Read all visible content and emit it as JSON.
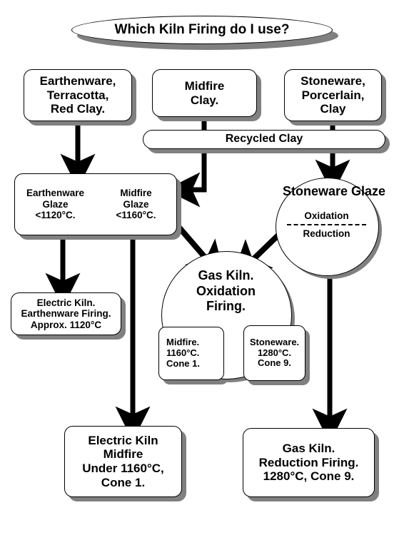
{
  "title": {
    "text": "Which Kiln Firing do I use?"
  },
  "clay_inputs": [
    {
      "name": "earthenware-clay",
      "lines": [
        "Earthenware,",
        "Terracotta,",
        "Red Clay."
      ]
    },
    {
      "name": "midfire-clay",
      "lines": [
        "Midfire",
        "Clay."
      ]
    },
    {
      "name": "stoneware-clay",
      "lines": [
        "Stoneware,",
        "Porcerlain,",
        "Clay"
      ]
    }
  ],
  "recycled": {
    "label": "Recycled Clay"
  },
  "glaze_box": {
    "left": {
      "lines": [
        "Earthenware",
        "Glaze",
        "<1120°C."
      ]
    },
    "right": {
      "lines": [
        "Midfire",
        "Glaze",
        "<1160°C."
      ]
    }
  },
  "stoneware_glaze": {
    "title": "Stoneware Glaze",
    "option_top": "Oxidation",
    "option_bottom": "Reduction"
  },
  "gas_kiln_oxidation": {
    "lines": [
      "Gas Kiln.",
      "Oxidation",
      "Firing."
    ]
  },
  "cone_boxes": [
    {
      "name": "midfire-cone",
      "lines": [
        "Midfire.",
        "1160°C.",
        "Cone 1."
      ]
    },
    {
      "name": "stoneware-cone",
      "lines": [
        "Stoneware.",
        "1280°C.",
        "Cone 9."
      ]
    }
  ],
  "outcomes": [
    {
      "name": "electric-earthenware",
      "lines": [
        "Electric Kiln.",
        "Earthenware Firing.",
        "Approx. 1120°C"
      ]
    },
    {
      "name": "electric-midfire",
      "lines": [
        "Electric Kiln",
        "Midfire",
        "Under 1160°C,",
        "Cone 1."
      ]
    },
    {
      "name": "gas-reduction",
      "lines": [
        "Gas Kiln.",
        "Reduction Firing.",
        "1280°C, Cone 9."
      ]
    }
  ],
  "colors": {
    "stroke": "#000000",
    "fill": "#ffffff",
    "shadow": "#808080"
  },
  "chart_data": {
    "type": "diagram",
    "title": "Which Kiln Firing do I use?",
    "nodes": [
      "Earthenware, Terracotta, Red Clay.",
      "Midfire Clay.",
      "Stoneware, Porcerlain, Clay",
      "Recycled Clay",
      "Earthenware Glaze <1120°C.",
      "Midfire Glaze <1160°C.",
      "Stoneware Glaze (Oxidation / Reduction)",
      "Gas Kiln. Oxidation Firing.",
      "Midfire. 1160°C. Cone 1.",
      "Stoneware. 1280°C. Cone 9.",
      "Electric Kiln. Earthenware Firing. Approx. 1120°C",
      "Electric Kiln Midfire Under 1160°C, Cone 1.",
      "Gas Kiln. Reduction Firing. 1280°C, Cone 9."
    ],
    "edges": [
      [
        "Earthenware, Terracotta, Red Clay.",
        "Earthenware Glaze <1120°C."
      ],
      [
        "Midfire Clay.",
        "Midfire Glaze <1160°C."
      ],
      [
        "Stoneware, Porcerlain, Clay",
        "Stoneware Glaze (Oxidation / Reduction)"
      ],
      [
        "Earthenware Glaze <1120°C.",
        "Electric Kiln. Earthenware Firing. Approx. 1120°C"
      ],
      [
        "Midfire Glaze <1160°C.",
        "Electric Kiln Midfire Under 1160°C, Cone 1."
      ],
      [
        "Midfire Glaze <1160°C.",
        "Gas Kiln. Oxidation Firing."
      ],
      [
        "Stoneware Glaze (Oxidation / Reduction)",
        "Gas Kiln. Oxidation Firing."
      ],
      [
        "Stoneware Glaze (Oxidation / Reduction)",
        "Gas Kiln. Reduction Firing. 1280°C, Cone 9."
      ]
    ]
  }
}
